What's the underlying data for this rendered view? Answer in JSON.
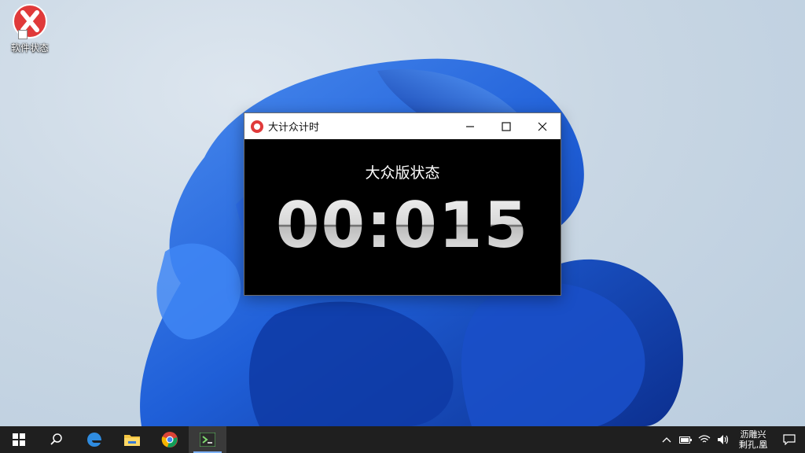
{
  "desktop": {
    "icon": {
      "label": "软件状态",
      "icon": "red-x-app-icon"
    }
  },
  "window": {
    "title": "大计众计时",
    "icon": "red-circle-app-icon",
    "controls": [
      "minimize-icon",
      "maximize-icon",
      "close-icon"
    ],
    "status_text": "大众版状态",
    "timer_display": "00:015"
  },
  "taskbar": {
    "apps": [
      "windows-start-icon",
      "search-icon",
      "edge-icon",
      "file-explorer-icon",
      "chrome-icon",
      "timer-app-icon"
    ],
    "tray": [
      "chevron-up-icon",
      "battery-icon",
      "wifi-icon",
      "volume-icon",
      "notification-icon"
    ],
    "time_line1": "沥雕兴",
    "time_line2": "剩孔,凰"
  },
  "colors": {
    "accent": "#e03a3a",
    "taskbar": "#1f1f1f",
    "wallpaper_blue": "#1d5fd6"
  }
}
